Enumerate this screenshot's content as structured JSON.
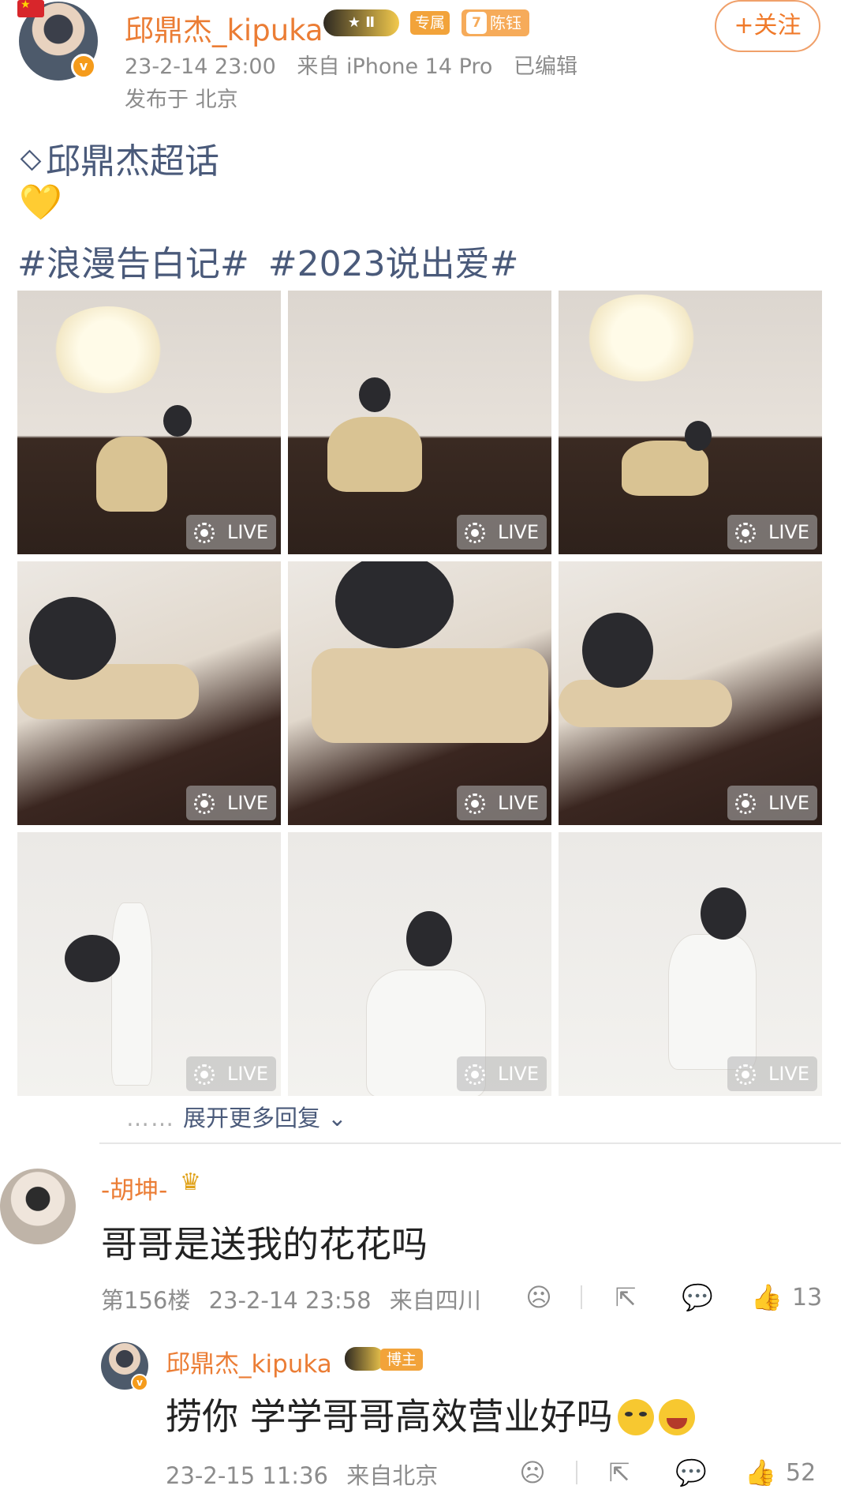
{
  "post": {
    "author": "邱鼎杰_kipuka",
    "vip_level": "Ⅱ",
    "tag_exclusive": "专属",
    "fan_badge_level": "7",
    "fan_badge_name": "陈钰",
    "follow_label": "+关注",
    "date": "23-2-14 23:00",
    "source": "来自 iPhone 14 Pro",
    "edited": "已编辑",
    "location": "发布于 北京",
    "supertopic": "邱鼎杰超话",
    "heart": "💛",
    "hashtags": [
      "#浪漫告白记#",
      "#2023说出爱#"
    ],
    "live_label": "LIVE",
    "photo_count": 9
  },
  "thread": {
    "expand_dots": "……",
    "expand_label": "展开更多回复 ⌄"
  },
  "comment": {
    "author": "-胡坤-",
    "crown_icon": "crown-icon",
    "text": "哥哥是送我的花花吗",
    "floor": "第156楼",
    "date": "23-2-14 23:58",
    "location": "来自四川",
    "likes": "13"
  },
  "reply": {
    "author": "邱鼎杰_kipuka",
    "tag": "博主",
    "text": "捞你 学学哥哥高效营业好吗",
    "date": "23-2-15 11:36",
    "location": "来自北京",
    "likes": "52"
  },
  "icons": {
    "dislike": "☹",
    "share": "⇱",
    "comment": "💬",
    "like": "👍"
  }
}
